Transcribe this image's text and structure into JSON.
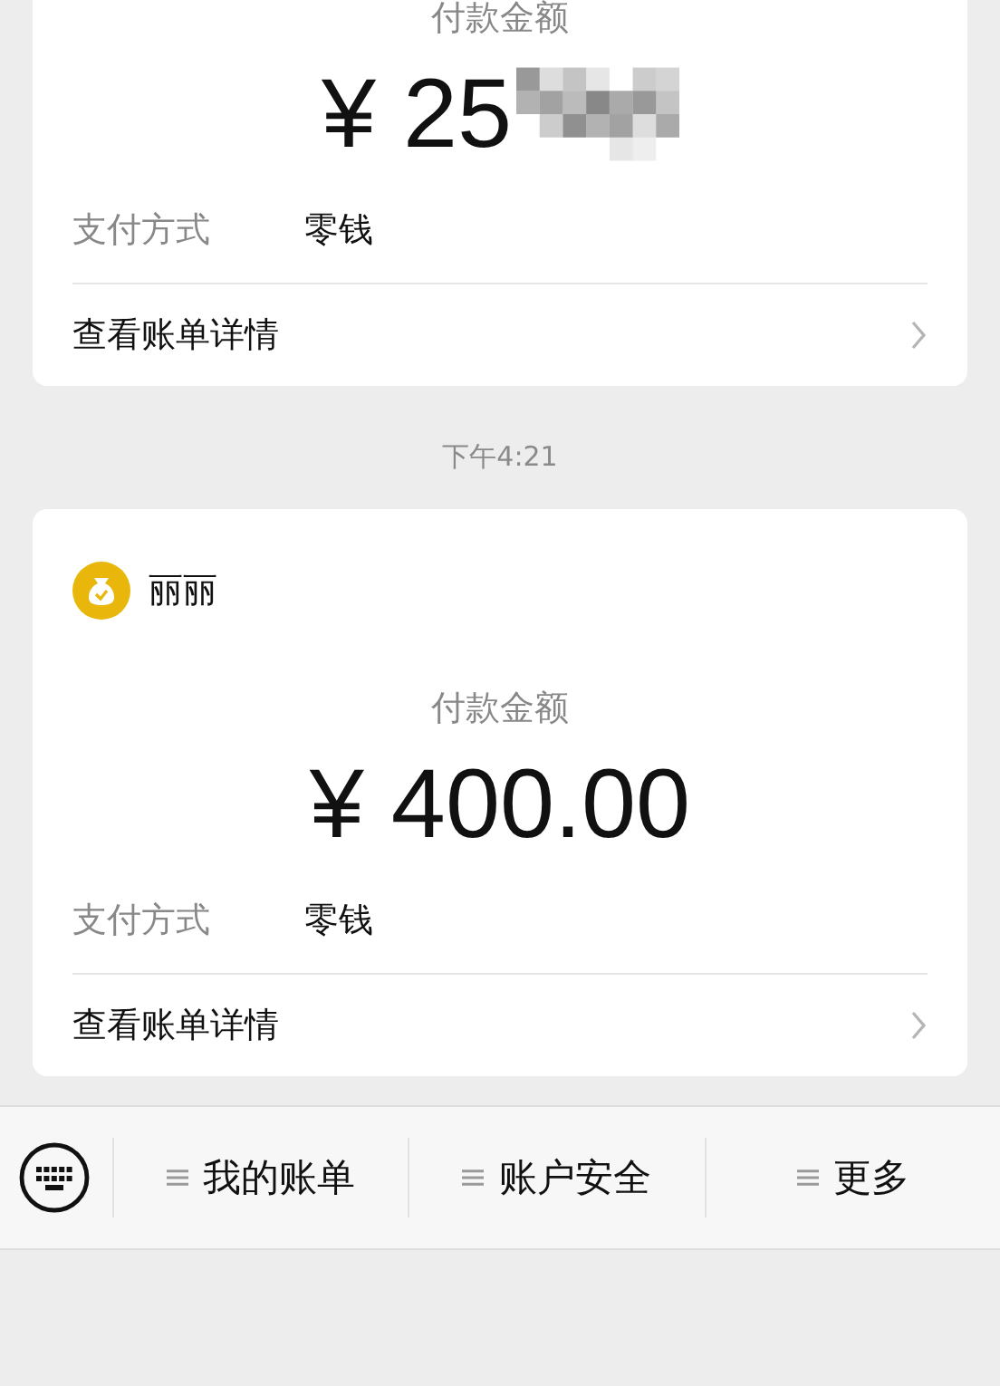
{
  "payments": [
    {
      "amount_label": "付款金额",
      "amount": "¥ 25",
      "amount_masked": true,
      "method_label": "支付方式",
      "method": "零钱",
      "details_link": "查看账单详情"
    },
    {
      "time": "下午4:21",
      "merchant": "丽丽",
      "amount_label": "付款金额",
      "amount": "¥ 400.00",
      "amount_masked": false,
      "method_label": "支付方式",
      "method": "零钱",
      "details_link": "查看账单详情"
    }
  ],
  "menu": [
    {
      "label": "我的账单"
    },
    {
      "label": "账户安全"
    },
    {
      "label": "更多"
    }
  ]
}
